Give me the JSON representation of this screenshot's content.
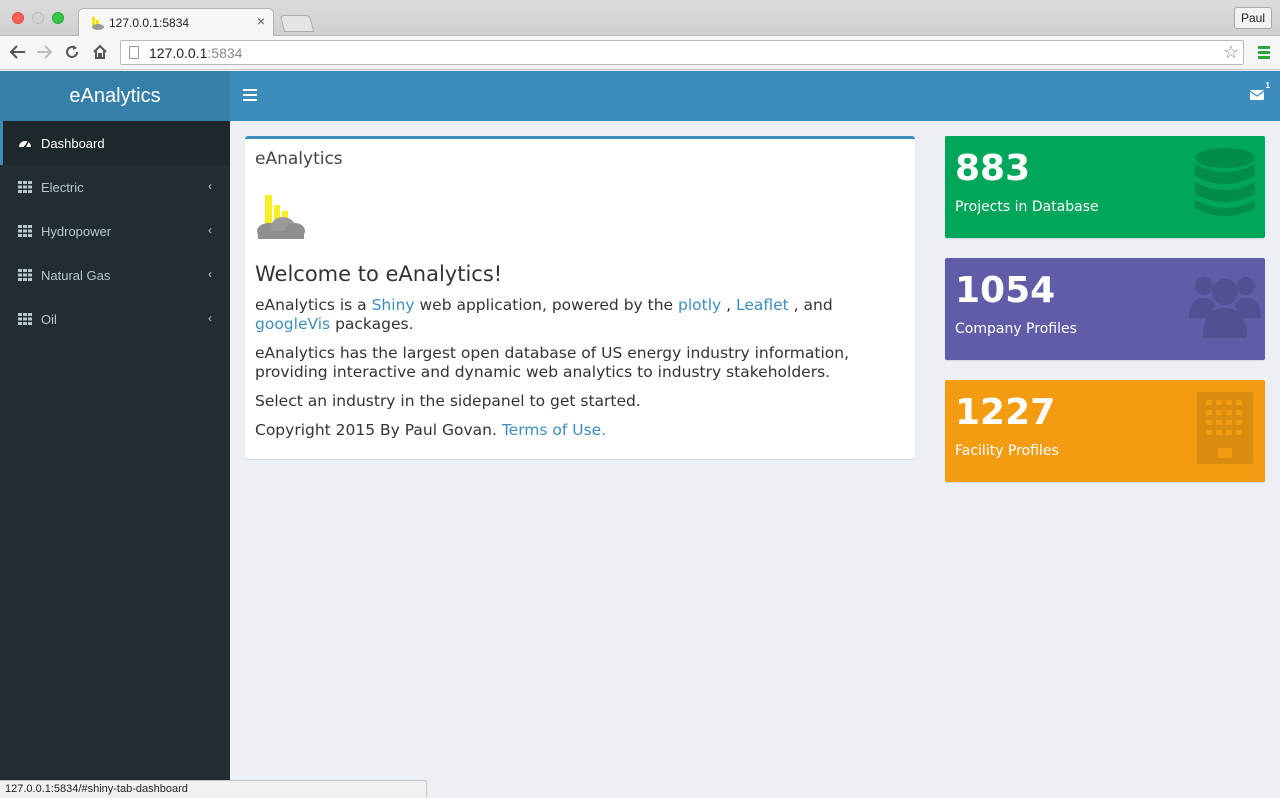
{
  "browser": {
    "tab_title": "127.0.0.1:5834",
    "url_host": "127.0.0.1",
    "url_port": ":5834",
    "profile": "Paul",
    "status_url": "127.0.0.1:5834/#shiny-tab-dashboard"
  },
  "header": {
    "brand": "eAnalytics",
    "messages_badge": "1"
  },
  "sidebar": {
    "items": [
      {
        "label": "Dashboard",
        "icon": "dashboard-icon",
        "active": true
      },
      {
        "label": "Electric",
        "icon": "grid-icon"
      },
      {
        "label": "Hydropower",
        "icon": "grid-icon"
      },
      {
        "label": "Natural Gas",
        "icon": "grid-icon"
      },
      {
        "label": "Oil",
        "icon": "grid-icon"
      }
    ]
  },
  "main": {
    "box_title": "eAnalytics",
    "welcome": "Welcome to eAnalytics!",
    "p1_pre": "eAnalytics is a ",
    "p1_link_shiny": "Shiny",
    "p1_mid": " web application, powered by the ",
    "p1_link_plotly": "plotly",
    "p1_sep1": " , ",
    "p1_link_leaflet": "Leaflet",
    "p1_sep2": " , and ",
    "p1_link_googlevis": "googleVis",
    "p1_post": " packages.",
    "p2": "eAnalytics has the largest open database of US energy industry information, providing interactive and dynamic web analytics to industry stakeholders.",
    "p3": "Select an industry in the sidepanel to get started.",
    "p4_pre": "Copyright 2015 By Paul Govan. ",
    "p4_link": "Terms of Use."
  },
  "info_boxes": [
    {
      "value": "883",
      "label": "Projects in Database",
      "color": "#00a65a",
      "icon": "database-icon"
    },
    {
      "value": "1054",
      "label": "Company Profiles",
      "color": "#605ca8",
      "icon": "users-icon"
    },
    {
      "value": "1227",
      "label": "Facility Profiles",
      "color": "#f39c12",
      "icon": "building-icon"
    }
  ]
}
